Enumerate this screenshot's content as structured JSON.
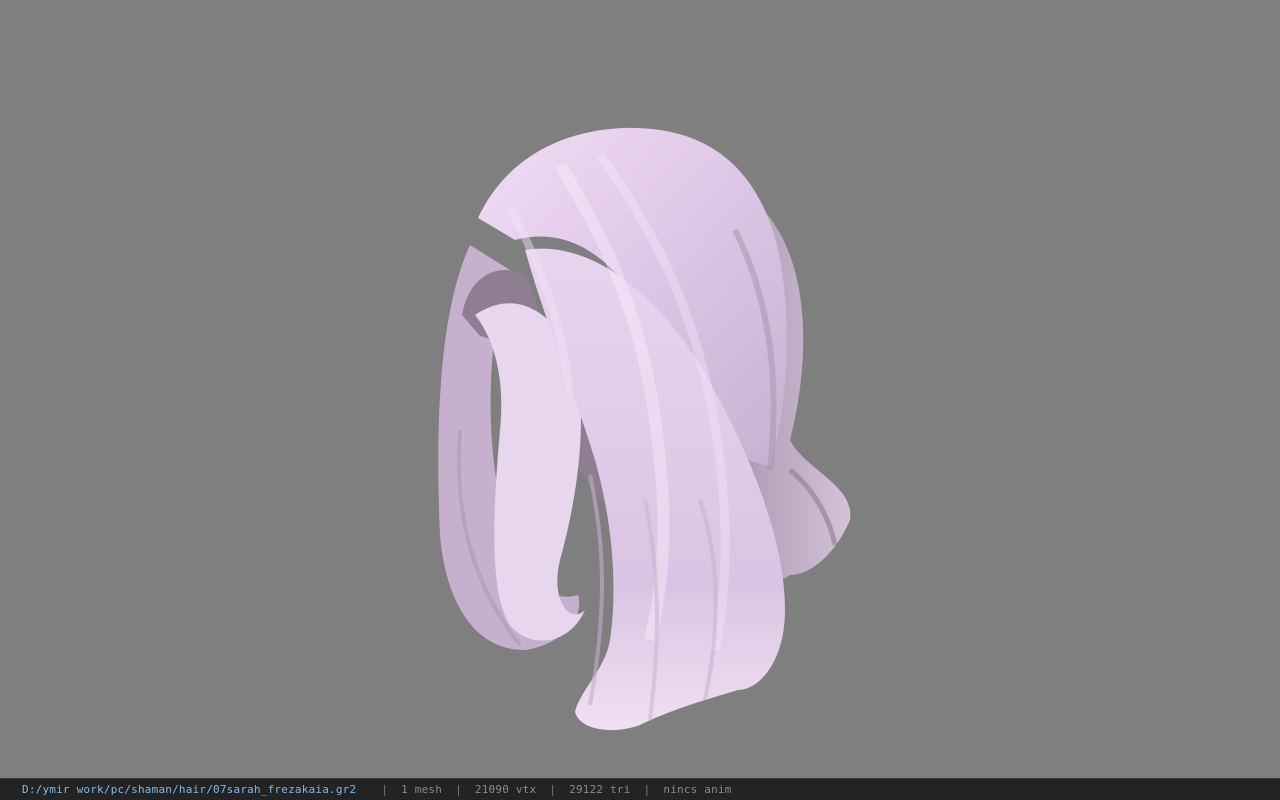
{
  "viewer": {
    "background_color": "#808080",
    "model": {
      "icon": "hair-mesh-icon",
      "base_color": "#d6c1df",
      "highlight_color": "#f1ddf5",
      "shadow_color": "#8f7d92"
    }
  },
  "status": {
    "file_path": "D:/ymir work/pc/shaman/hair/07sarah_frezakaia.gr2",
    "separator": "|",
    "meshes": "1 mesh",
    "vertices": "21090 vtx",
    "triangles": "29122 tri",
    "animation": "nincs anim"
  }
}
